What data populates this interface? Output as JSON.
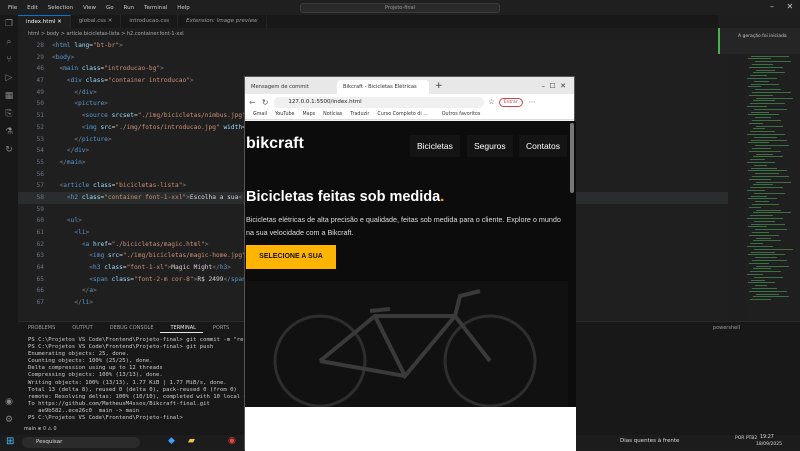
{
  "vscode": {
    "menu": [
      "File",
      "Edit",
      "Selection",
      "View",
      "Go",
      "Run",
      "Terminal",
      "Help"
    ],
    "command_center": "Projeto-final",
    "tabs": [
      {
        "label": "index.html",
        "active": true
      },
      {
        "label": "global.css",
        "active": false
      },
      {
        "label": "introducao.css",
        "active": false
      },
      {
        "label": "Extension: Image preview",
        "active": false
      }
    ],
    "breadcrumb": "html > body > article.bicicletas-lista > h2.container.font-1-xxl",
    "code_lines": [
      {
        "n": "28",
        "html": "<span class='p'>&lt;</span><span class='t'>html</span> <span class='a'>lang</span>=<span class='s'>\"bt-br\"</span><span class='p'>&gt;</span>"
      },
      {
        "n": "29",
        "html": "<span class='p'>&lt;</span><span class='t'>body</span><span class='p'>&gt;</span>"
      },
      {
        "n": "46",
        "html": "  <span class='p'>&lt;</span><span class='t'>main</span> <span class='a'>class</span>=<span class='s'>\"introducao-bg\"</span><span class='p'>&gt;</span>"
      },
      {
        "n": "47",
        "html": "    <span class='p'>&lt;</span><span class='t'>div</span> <span class='a'>class</span>=<span class='s'>\"container introducao\"</span><span class='p'>&gt;</span>"
      },
      {
        "n": "49",
        "html": "      <span class='p'>&lt;/</span><span class='t'>div</span><span class='p'>&gt;</span>"
      },
      {
        "n": "50",
        "html": "      <span class='p'>&lt;</span><span class='t'>picture</span><span class='p'>&gt;</span>"
      },
      {
        "n": "51",
        "html": "        <span class='p'>&lt;</span><span class='t'>source</span> <span class='a'>srcset</span>=<span class='s'>\"./img/bicicletas/nimbus.jpg\"</span>"
      },
      {
        "n": "52",
        "html": "        <span class='p'>&lt;</span><span class='t'>img</span> <span class='a'>src</span>=<span class='s'>\"./img/fotos/introducao.jpg\"</span> <span class='a'>width</span>="
      },
      {
        "n": "53",
        "html": "      <span class='p'>&lt;/</span><span class='t'>picture</span><span class='p'>&gt;</span>"
      },
      {
        "n": "54",
        "html": "    <span class='p'>&lt;/</span><span class='t'>div</span><span class='p'>&gt;</span>"
      },
      {
        "n": "55",
        "html": "  <span class='p'>&lt;/</span><span class='t'>main</span><span class='p'>&gt;</span>"
      },
      {
        "n": "56",
        "html": ""
      },
      {
        "n": "57",
        "html": "  <span class='p'>&lt;</span><span class='t'>article</span> <span class='a'>class</span>=<span class='s'>\"bicicletas-lista\"</span><span class='p'>&gt;</span>"
      },
      {
        "n": "58",
        "html": "    <span class='p'>&lt;</span><span class='t'>h2</span> <span class='a'>class</span>=<span class='s'>\"container font-1-xxl\"</span><span class='p'>&gt;</span>Escolha a sua<span class='p'>&lt;</span>",
        "hl": true
      },
      {
        "n": "59",
        "html": ""
      },
      {
        "n": "60",
        "html": "    <span class='p'>&lt;</span><span class='t'>ul</span><span class='p'>&gt;</span>"
      },
      {
        "n": "61",
        "html": "      <span class='p'>&lt;</span><span class='t'>li</span><span class='p'>&gt;</span>"
      },
      {
        "n": "62",
        "html": "        <span class='p'>&lt;</span><span class='t'>a</span> <span class='a'>href</span>=<span class='s'>\"./bicicletas/magic.html\"</span><span class='p'>&gt;</span>"
      },
      {
        "n": "63",
        "html": "          <span class='p'>&lt;</span><span class='t'>img</span> <span class='a'>src</span>=<span class='s'>\"./img/bicicletas/magic-home.jpg\"</span>"
      },
      {
        "n": "64",
        "html": "          <span class='p'>&lt;</span><span class='t'>h3</span> <span class='a'>class</span>=<span class='s'>\"font-1-xl\"</span><span class='p'>&gt;</span>Magic Might<span class='p'>&lt;/</span><span class='t'>h3</span><span class='p'>&gt;</span>"
      },
      {
        "n": "65",
        "html": "          <span class='p'>&lt;</span><span class='t'>span</span> <span class='a'>class</span>=<span class='s'>\"font-2-m cor-8\"</span><span class='p'>&gt;</span>R$ 2499<span class='p'>&lt;/</span><span class='t'>span</span>"
      },
      {
        "n": "66",
        "html": "        <span class='p'>&lt;/</span><span class='t'>a</span><span class='p'>&gt;</span>"
      },
      {
        "n": "67",
        "html": "      <span class='p'>&lt;/</span><span class='t'>li</span><span class='p'>&gt;</span>"
      }
    ],
    "copilot_note": "A geração foi iniciada",
    "panel_tabs": [
      "PROBLEMS",
      "OUTPUT",
      "DEBUG CONSOLE",
      "TERMINAL",
      "PORTS"
    ],
    "terminal_label": "powershell",
    "terminal_lines": [
      "PS C:\\Projetos VS Code\\Frontend\\Projeto-final> git commit -m \"refactor: CS",
      "PS C:\\Projetos VS Code\\Frontend\\Projeto-final> git push",
      "Enumerating objects: 25, done.",
      "Counting objects: 100% (25/25), done.",
      "Delta compression using up to 12 threads",
      "Compressing objects: 100% (13/13), done.",
      "Writing objects: 100% (13/13), 1.77 KiB | 1.77 MiB/s, done.",
      "Total 13 (delta 8), reused 0 (delta 0), pack-reused 0 (from 0)",
      "remote: Resolving deltas: 100% (10/10), completed with 10 local objects.",
      "To https://github.com/MatheusM4ssos/Bikcraft-final.git",
      "   ae9b582..ece26c0  main -> main",
      "PS C:\\Projetos VS Code\\Frontend\\Projeto-final> "
    ],
    "status_left": "main  ⊗ 0 ⚠ 0",
    "status_right": "Ln 58, Col 94   Spaces: 2   UTF-8   CRLF   HTML   Port : 5500"
  },
  "browser": {
    "tabs": [
      "Mensagem de commit",
      "Bikcraft - Bicicletas Elétricas"
    ],
    "url": "127.0.0.1:5500/index.html",
    "entrar": "Entrar",
    "favorites": [
      "Gmail",
      "YouTube",
      "Maps",
      "Notícias",
      "Traduzir",
      "Curso Completo di ..."
    ],
    "other_favorites": "Outros favoritos"
  },
  "site": {
    "logo": "bikcraft",
    "nav": [
      "Bicicletas",
      "Seguros",
      "Contatos"
    ],
    "headline": "Bicicletas feitas sob medida",
    "headline_dot": ".",
    "lead": "Bicicletas elétricas de alta precisão e qualidade, feitas sob medida para o cliente. Explore o mundo na sua velocidade com a Bikcraft.",
    "cta": "SELECIONE A SUA"
  },
  "taskbar": {
    "search": "Pesquisar",
    "weather": "Dias quentes à frente",
    "lang": "POR PTB2",
    "time": "19:27",
    "date": "18/09/2025"
  }
}
